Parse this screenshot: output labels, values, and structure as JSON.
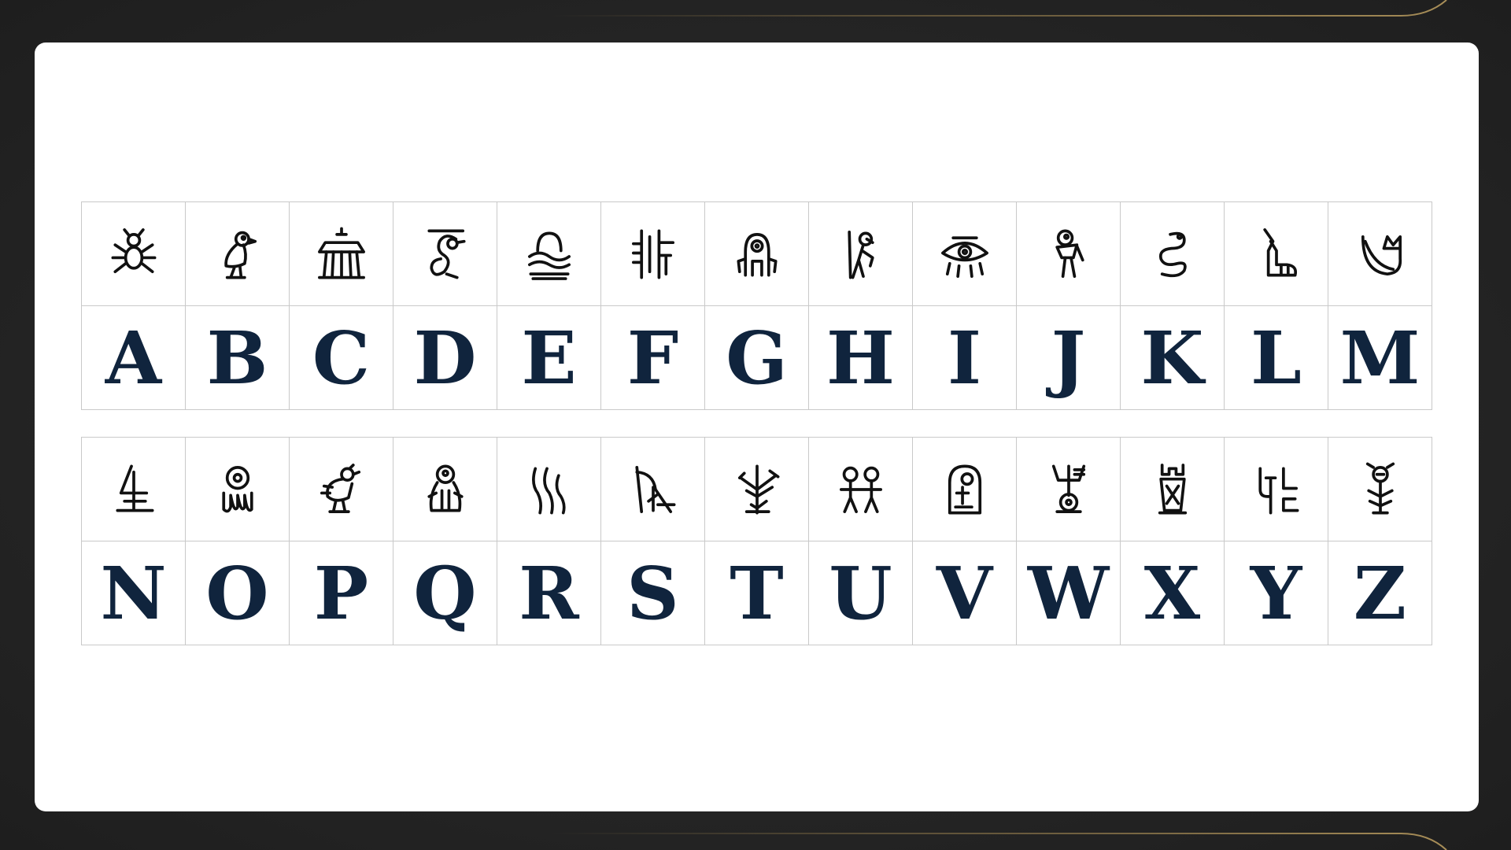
{
  "colors": {
    "background": "#262626",
    "card": "#ffffff",
    "letters": "#10243d",
    "glyph_stroke": "#111111",
    "cell_border": "#c9c9c9",
    "accent_line": "#8a7448"
  },
  "cipher": {
    "rows": [
      {
        "glyphs": [
          "spider-glyph",
          "bird-glyph",
          "temple-glyph",
          "swan-glyph",
          "mountain-water-glyph",
          "comb-glyph",
          "robot-glyph",
          "running-figure-glyph",
          "eye-glyph",
          "walking-figure-glyph",
          "serpent-glyph",
          "boot-glyph",
          "leaf-glyph"
        ],
        "letters": [
          "A",
          "B",
          "C",
          "D",
          "E",
          "F",
          "G",
          "H",
          "I",
          "J",
          "K",
          "L",
          "M"
        ]
      },
      {
        "glyphs": [
          "altar-glyph",
          "octopus-glyph",
          "chick-glyph",
          "ghost-glyph",
          "waves-glyph",
          "wave-cross-glyph",
          "branch-glyph",
          "twin-figures-glyph",
          "shrine-glyph",
          "trident-glyph",
          "jar-glyph",
          "hooks-glyph",
          "sprout-glyph"
        ],
        "letters": [
          "N",
          "O",
          "P",
          "Q",
          "R",
          "S",
          "T",
          "U",
          "V",
          "W",
          "X",
          "Y",
          "Z"
        ]
      }
    ]
  }
}
